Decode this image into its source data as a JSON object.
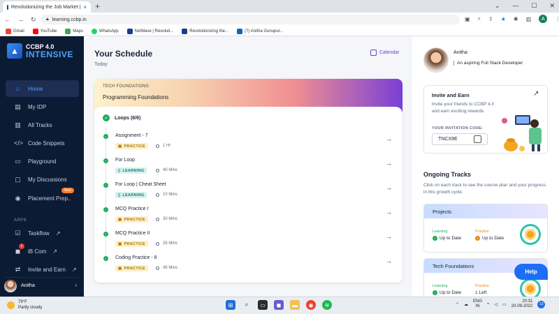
{
  "browser": {
    "tab_title": "Revolutionizing the Job Market |",
    "tab_close": "×",
    "new_tab": "+",
    "url": "learning.ccbp.in",
    "bookmarks": [
      {
        "label": "Gmail",
        "icon": "gmail-icon",
        "color": "#ea4335"
      },
      {
        "label": "YouTube",
        "icon": "youtube-icon",
        "color": "#ff0000"
      },
      {
        "label": "Maps",
        "icon": "maps-icon",
        "color": "#34a853"
      },
      {
        "label": "WhatsApp",
        "icon": "whatsapp-icon",
        "color": "#25d366"
      },
      {
        "label": "NxtWave | Revoluti...",
        "icon": "nxtwave-icon",
        "color": "#1e3a8a"
      },
      {
        "label": "Revolutionizing the...",
        "icon": "nxtwave-icon",
        "color": "#1e3a8a"
      },
      {
        "label": "(7) Anitha Gunupur...",
        "icon": "linkedin-icon",
        "color": "#0a66c2"
      }
    ],
    "profile_initial": "A"
  },
  "sidebar": {
    "logo_line1": "CCBP 4.0",
    "logo_line2": "INTENSIVE",
    "items": [
      {
        "label": "Home",
        "icon": "home-icon",
        "active": true
      },
      {
        "label": "My IDP",
        "icon": "idp-icon"
      },
      {
        "label": "All Tracks",
        "icon": "tracks-icon"
      },
      {
        "label": "Code Snippets",
        "icon": "code-icon"
      },
      {
        "label": "Playground",
        "icon": "playground-icon"
      },
      {
        "label": "My Discussions",
        "icon": "discussions-icon"
      },
      {
        "label": "Placement Prep..",
        "icon": "placement-icon"
      }
    ],
    "new_badge": "New",
    "apps_heading": "APPS",
    "apps": [
      {
        "label": "Taskflow",
        "icon": "taskflow-icon"
      },
      {
        "label": "iB Com",
        "icon": "ibcom-icon"
      },
      {
        "label": "Invite and Earn",
        "icon": "invite-icon"
      }
    ],
    "ibcom_count": "1",
    "user_name": "Anitha"
  },
  "schedule": {
    "title": "Your Schedule",
    "subtitle": "Today",
    "calendar_label": "Calendar",
    "card_tag": "TECH FOUNDATIONS",
    "card_name": "Programming Foundations",
    "section": "Loops (6/6)",
    "items": [
      {
        "name": "Assignment - 7",
        "type": "PRACTICE",
        "duration": "1 Hr"
      },
      {
        "name": "For Loop",
        "type": "LEARNING",
        "duration": "40 Mins"
      },
      {
        "name": "For Loop | Cheat Sheet",
        "type": "LEARNING",
        "duration": "10 Mins"
      },
      {
        "name": "MCQ Practice I",
        "type": "PRACTICE",
        "duration": "30 Mins"
      },
      {
        "name": "MCQ Practice II",
        "type": "PRACTICE",
        "duration": "35 Mins"
      },
      {
        "name": "Coding Practice - 8",
        "type": "PRACTICE",
        "duration": "45 Mins"
      }
    ]
  },
  "profile": {
    "name": "Anitha",
    "bio": "An aspiring Full Stack Developer"
  },
  "invite": {
    "title": "Invite and Earn",
    "desc": "Invite your friends to CCBP 4.0 and earn exciting rewards",
    "code_label": "YOUR INVITATION CODE:",
    "code": "TNCX9E"
  },
  "ongoing": {
    "title": "Ongoing Tracks",
    "desc": "Click on each track to see the course plan and your progress in this growth cycle.",
    "tracks": [
      {
        "name": "Projects",
        "learning_label": "Learning",
        "learning_value": "Up to Date",
        "practice_label": "Practice",
        "practice_value": "Up to Date"
      },
      {
        "name": "Tech Foundations",
        "learning_label": "Learning",
        "learning_value": "Up to Date",
        "practice_label": "Practice",
        "practice_value": "1 Left"
      }
    ]
  },
  "help_label": "Help",
  "taskbar": {
    "temp": "79°F",
    "weather": "Partly cloudy",
    "lang1": "ENG",
    "lang2": "IN",
    "time": "20:31",
    "date": "20-09-2022",
    "notif_count": "13"
  }
}
